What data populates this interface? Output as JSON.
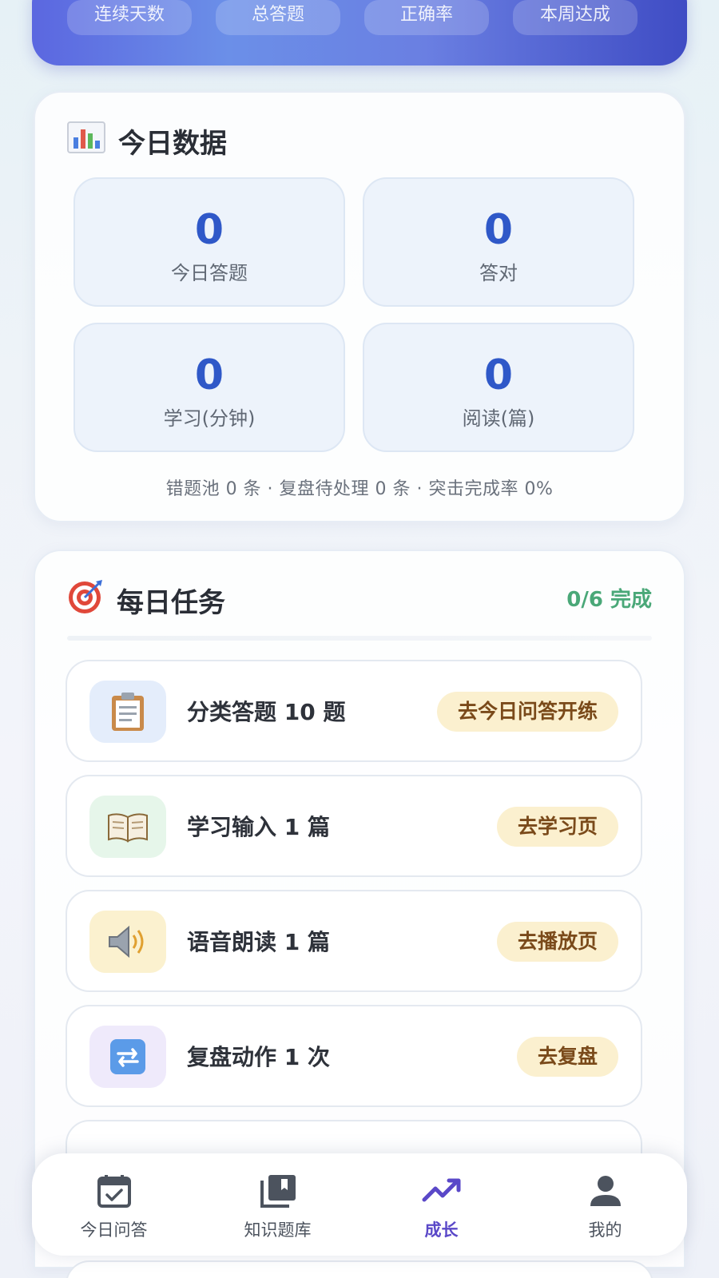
{
  "banner": {
    "chips": [
      "连续天数",
      "总答题",
      "正确率",
      "本周达成"
    ]
  },
  "today": {
    "icon": "bar-chart-icon",
    "title": "今日数据",
    "stats": [
      {
        "value": "0",
        "label": "今日答题"
      },
      {
        "value": "0",
        "label": "答对"
      },
      {
        "value": "0",
        "label": "学习(分钟)"
      },
      {
        "value": "0",
        "label": "阅读(篇)"
      }
    ],
    "summary": "错题池 0 条 · 复盘待处理 0 条 · 突击完成率 0%"
  },
  "tasks": {
    "icon": "target-icon",
    "title": "每日任务",
    "progress": "0/6 完成",
    "items": [
      {
        "icon": "clipboard-icon",
        "label": "分类答题 10 题",
        "action": "去今日问答开练",
        "icon_bg": "#e4edfb"
      },
      {
        "icon": "open-book-icon",
        "label": "学习输入 1 篇",
        "action": "去学习页",
        "icon_bg": "#e6f6ea"
      },
      {
        "icon": "speaker-icon",
        "label": "语音朗读 1 篇",
        "action": "去播放页",
        "icon_bg": "#fbf1cf"
      },
      {
        "icon": "repeat-icon",
        "label": "复盘动作 1 次",
        "action": "去复盘",
        "icon_bg": "#efeafb"
      }
    ]
  },
  "nav": {
    "items": [
      {
        "icon": "calendar-check-icon",
        "label": "今日问答"
      },
      {
        "icon": "library-icon",
        "label": "知识题库"
      },
      {
        "icon": "trending-up-icon",
        "label": "成长"
      },
      {
        "icon": "person-icon",
        "label": "我的"
      }
    ],
    "active_index": 2
  },
  "colors": {
    "accent": "#2f58c8",
    "success": "#4aa878",
    "nav_active": "#5a48c8"
  }
}
